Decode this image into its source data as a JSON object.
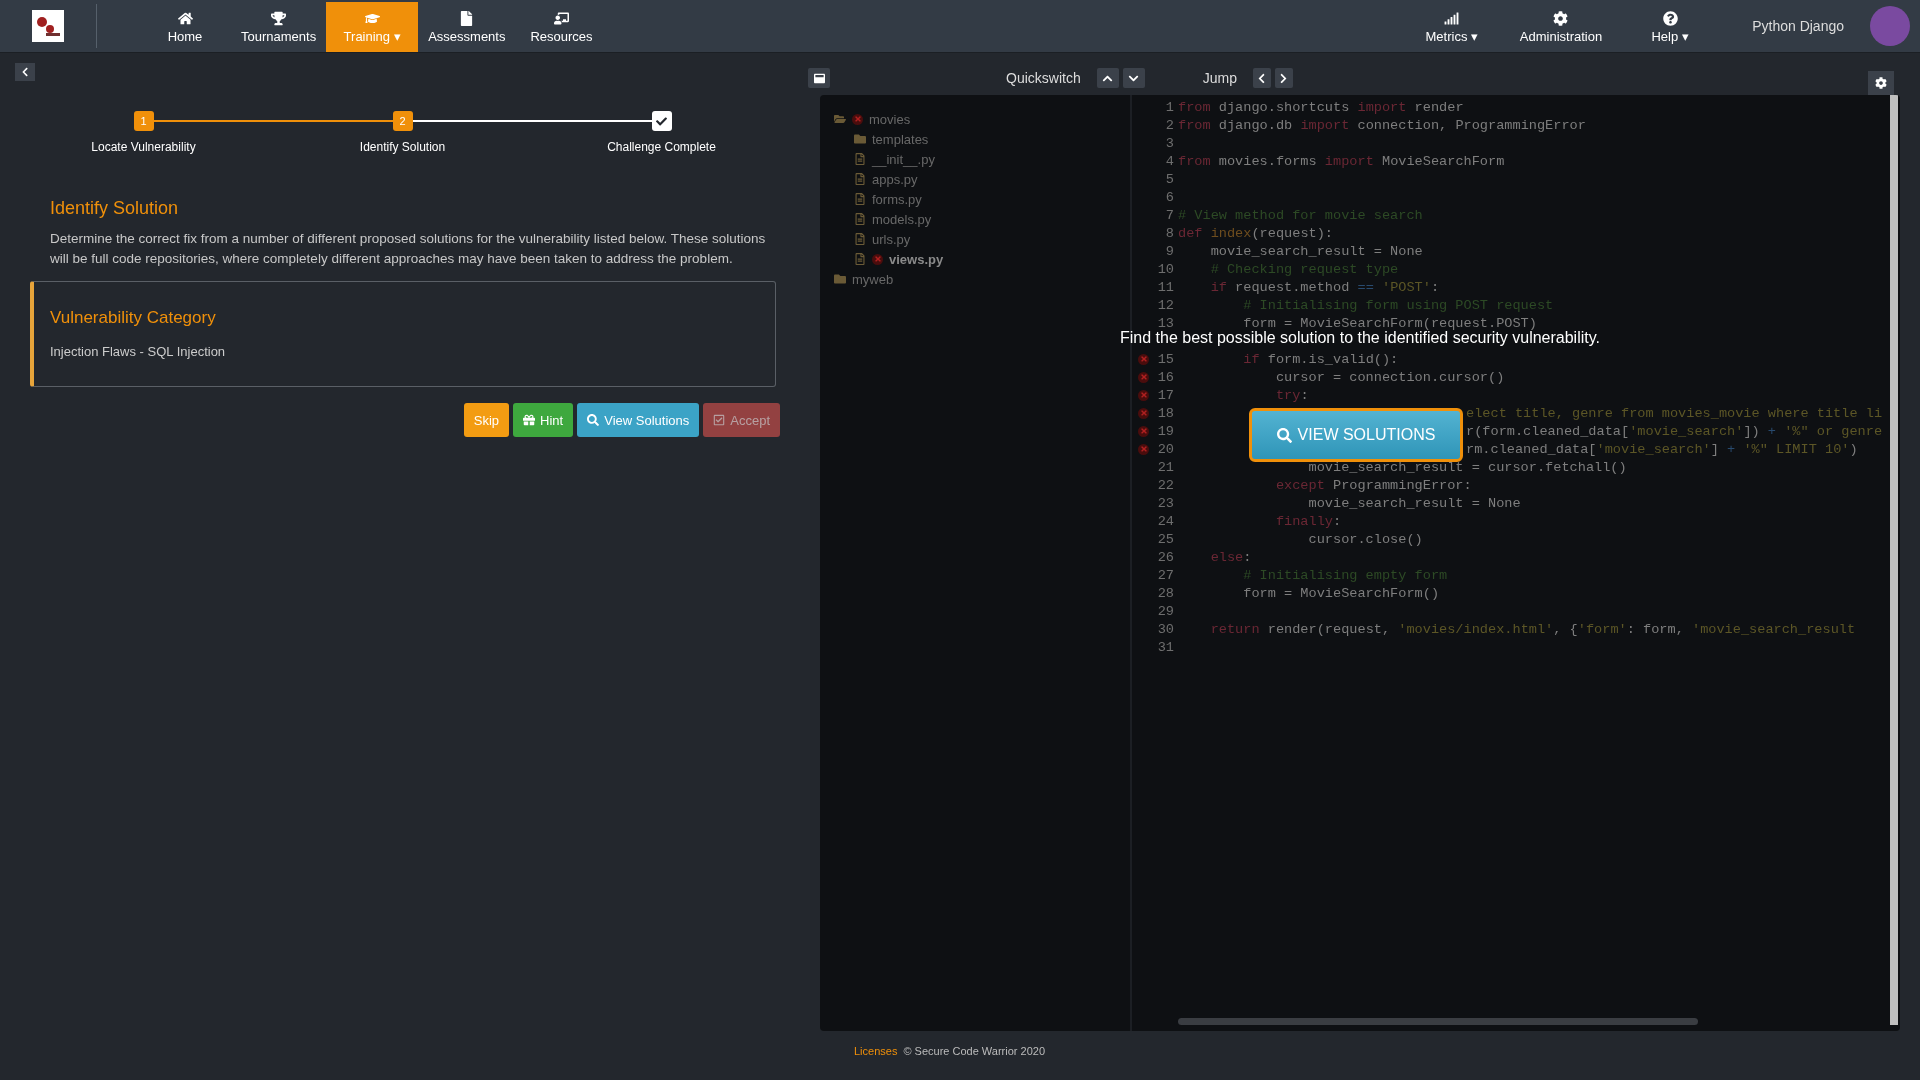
{
  "nav": {
    "items": [
      {
        "label": "Home",
        "selected": false
      },
      {
        "label": "Tournaments",
        "selected": false
      },
      {
        "label": "Training ▾",
        "selected": true
      },
      {
        "label": "Assessments",
        "selected": false
      },
      {
        "label": "Resources",
        "selected": false
      }
    ],
    "right_items": [
      {
        "label": "Metrics ▾"
      },
      {
        "label": "Administration"
      },
      {
        "label": "Help ▾"
      }
    ],
    "user": "Python Django"
  },
  "steps": [
    {
      "number": "1",
      "label": "Locate Vulnerability",
      "reached": true,
      "kind": "number"
    },
    {
      "number": "2",
      "label": "Identify Solution",
      "reached": true,
      "kind": "number"
    },
    {
      "label": "Challenge Complete",
      "reached": false,
      "kind": "check"
    }
  ],
  "section": {
    "title": "Identify Solution",
    "text": "Determine the correct fix from a number of different proposed solutions for the vulnerability listed below. These solutions will be full code repositories, where completely different approaches may have been taken to address the problem."
  },
  "category": {
    "title": "Vulnerability Category",
    "value": "Injection Flaws - SQL Injection"
  },
  "actions": [
    {
      "label": "Skip",
      "kind": "skip",
      "disabled": false
    },
    {
      "label": "Hint",
      "kind": "hint",
      "disabled": false
    },
    {
      "label": "View Solutions",
      "kind": "view",
      "disabled": false
    },
    {
      "label": "Accept",
      "kind": "accept",
      "disabled": true
    }
  ],
  "editor": {
    "quickswitch": "Quickswitch",
    "jump": "Jump",
    "tree": [
      {
        "name": "movies",
        "kind": "folder",
        "expanded": true,
        "error": true,
        "selected": false,
        "children": [
          {
            "name": "templates",
            "kind": "folder",
            "expanded": false,
            "error": false,
            "selected": false
          },
          {
            "name": "__init__.py",
            "kind": "file",
            "error": false,
            "selected": false
          },
          {
            "name": "apps.py",
            "kind": "file",
            "error": false,
            "selected": false
          },
          {
            "name": "forms.py",
            "kind": "file",
            "error": false,
            "selected": false
          },
          {
            "name": "models.py",
            "kind": "file",
            "error": false,
            "selected": false
          },
          {
            "name": "urls.py",
            "kind": "file",
            "error": false,
            "selected": false
          },
          {
            "name": "views.py",
            "kind": "file",
            "error": true,
            "selected": true
          }
        ]
      },
      {
        "name": "myweb",
        "kind": "folder",
        "expanded": false,
        "error": false,
        "selected": false
      }
    ],
    "lines": [
      {
        "number": "1",
        "tokens": [
          {
            "kind": "kw",
            "text": "from"
          },
          {
            "kind": "tx",
            "text": " django.shortcuts "
          },
          {
            "kind": "kw",
            "text": "import"
          },
          {
            "kind": "tx",
            "text": " render"
          }
        ]
      },
      {
        "number": "2",
        "tokens": [
          {
            "kind": "kw",
            "text": "from"
          },
          {
            "kind": "tx",
            "text": " django.db "
          },
          {
            "kind": "kw",
            "text": "import"
          },
          {
            "kind": "tx",
            "text": " connection, ProgrammingError"
          }
        ]
      },
      {
        "number": "3"
      },
      {
        "number": "4",
        "tokens": [
          {
            "kind": "kw",
            "text": "from"
          },
          {
            "kind": "tx",
            "text": " movies.forms "
          },
          {
            "kind": "kw",
            "text": "import"
          },
          {
            "kind": "tx",
            "text": " MovieSearchForm"
          }
        ]
      },
      {
        "number": "5"
      },
      {
        "number": "6"
      },
      {
        "number": "7",
        "tokens": [
          {
            "kind": "cm",
            "text": "# View method for movie search"
          }
        ]
      },
      {
        "number": "8",
        "tokens": [
          {
            "kind": "kw",
            "text": "def"
          },
          {
            "kind": "fn",
            "text": " index"
          },
          {
            "kind": "tx",
            "text": "(request):"
          }
        ]
      },
      {
        "number": "9",
        "tokens": [
          {
            "kind": "tx",
            "text": "    movie_search_result = None"
          }
        ]
      },
      {
        "number": "10",
        "tokens": [
          {
            "kind": "cm",
            "text": "    # Checking request type"
          }
        ]
      },
      {
        "number": "11",
        "tokens": [
          {
            "kind": "kw",
            "text": "    if"
          },
          {
            "kind": "tx",
            "text": " request.method "
          },
          {
            "kind": "op",
            "text": "=="
          },
          {
            "kind": "str",
            "text": " 'POST'"
          },
          {
            "kind": "tx",
            "text": ":"
          }
        ]
      },
      {
        "number": "12",
        "tokens": [
          {
            "kind": "cm",
            "text": "        # Initialising form using POST request"
          }
        ]
      },
      {
        "number": "13",
        "tokens": [
          {
            "kind": "tx",
            "text": "        form = MovieSearchForm(request.POST)"
          }
        ]
      },
      {
        "kind": "covered"
      },
      {
        "number": "15",
        "error": true,
        "tokens": [
          {
            "kind": "kw",
            "text": "        if"
          },
          {
            "kind": "tx",
            "text": " form.is_valid():"
          }
        ]
      },
      {
        "number": "16",
        "error": true,
        "tokens": [
          {
            "kind": "tx",
            "text": "            cursor = connection.cursor()"
          }
        ]
      },
      {
        "number": "17",
        "error": true,
        "tokens": [
          {
            "kind": "kw",
            "text": "            try"
          },
          {
            "kind": "tx",
            "text": ":"
          }
        ]
      },
      {
        "number": "18",
        "kind": "partial",
        "error": true,
        "tokens": [
          {
            "kind": "str",
            "text": "elect title, genre from movies_movie where title li"
          }
        ]
      },
      {
        "number": "19",
        "kind": "partial",
        "error": true,
        "tokens": [
          {
            "kind": "tx",
            "text": "r(form.cleaned_data["
          },
          {
            "kind": "str",
            "text": "'movie_search'"
          },
          {
            "kind": "tx",
            "text": "]) "
          },
          {
            "kind": "op",
            "text": "+"
          },
          {
            "kind": "str",
            "text": " '%\" or genre"
          }
        ]
      },
      {
        "number": "20",
        "kind": "partial",
        "error": true,
        "tokens": [
          {
            "kind": "tx",
            "text": "rm.cleaned_data["
          },
          {
            "kind": "str",
            "text": "'movie_search'"
          },
          {
            "kind": "tx",
            "text": "] "
          },
          {
            "kind": "op",
            "text": "+"
          },
          {
            "kind": "str",
            "text": " '%\" LIMIT 10'"
          },
          {
            "kind": "tx",
            "text": ")"
          }
        ]
      },
      {
        "number": "21",
        "tokens": [
          {
            "kind": "tx",
            "text": "                movie_search_result = cursor.fetchall()"
          }
        ]
      },
      {
        "number": "22",
        "tokens": [
          {
            "kind": "kw",
            "text": "            except"
          },
          {
            "kind": "tx",
            "text": " ProgrammingError:"
          }
        ]
      },
      {
        "number": "23",
        "tokens": [
          {
            "kind": "tx",
            "text": "                movie_search_result = None"
          }
        ]
      },
      {
        "number": "24",
        "tokens": [
          {
            "kind": "kw",
            "text": "            finally"
          },
          {
            "kind": "tx",
            "text": ":"
          }
        ]
      },
      {
        "number": "25",
        "tokens": [
          {
            "kind": "tx",
            "text": "                cursor.close()"
          }
        ]
      },
      {
        "number": "26",
        "tokens": [
          {
            "kind": "kw",
            "text": "    else"
          },
          {
            "kind": "tx",
            "text": ":"
          }
        ]
      },
      {
        "number": "27",
        "tokens": [
          {
            "kind": "cm",
            "text": "        # Initialising empty form"
          }
        ]
      },
      {
        "number": "28",
        "tokens": [
          {
            "kind": "tx",
            "text": "        form = MovieSearchForm()"
          }
        ]
      },
      {
        "number": "29"
      },
      {
        "number": "30",
        "tokens": [
          {
            "kind": "kw",
            "text": "    return"
          },
          {
            "kind": "tx",
            "text": " render(request, "
          },
          {
            "kind": "str",
            "text": "'movies/index.html'"
          },
          {
            "kind": "tx",
            "text": ", {"
          },
          {
            "kind": "str",
            "text": "'form'"
          },
          {
            "kind": "tx",
            "text": ": form, "
          },
          {
            "kind": "str",
            "text": "'movie_search_result"
          }
        ]
      },
      {
        "number": "31"
      }
    ],
    "overlay": {
      "message": "Find the best possible solution to the identified security vulnerability.",
      "button": "VIEW SOLUTIONS"
    }
  },
  "footer": {
    "link": "Licenses",
    "text": "© Secure Code Warrior 2020"
  }
}
